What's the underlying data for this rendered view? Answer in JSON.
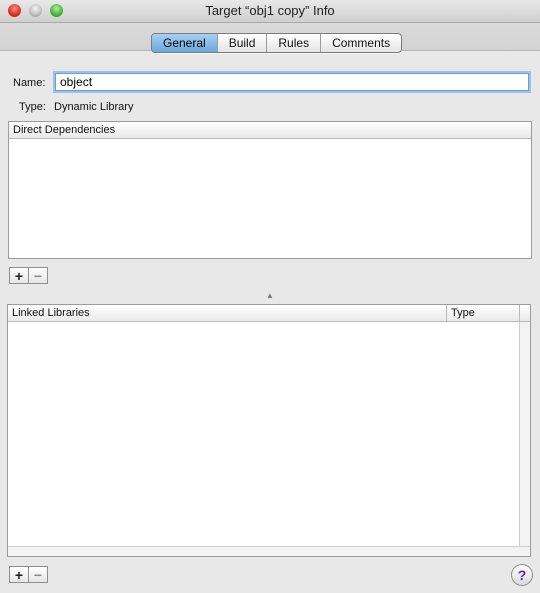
{
  "window": {
    "title": "Target “obj1 copy” Info"
  },
  "tabs": [
    {
      "label": "General",
      "active": true
    },
    {
      "label": "Build",
      "active": false
    },
    {
      "label": "Rules",
      "active": false
    },
    {
      "label": "Comments",
      "active": false
    }
  ],
  "general": {
    "name_label": "Name:",
    "name_value": "object",
    "type_label": "Type:",
    "type_value": "Dynamic Library"
  },
  "direct_dependencies": {
    "header": "Direct Dependencies",
    "add_label": "+",
    "remove_label": "−"
  },
  "linked_libraries": {
    "header_name": "Linked Libraries",
    "header_type": "Type",
    "add_label": "+",
    "remove_label": "−"
  },
  "help": {
    "label": "?"
  },
  "colors": {
    "accent": "#6aa8df",
    "close": "#d6321f",
    "minimize": "#bdbdbd",
    "zoom": "#48b13a"
  }
}
